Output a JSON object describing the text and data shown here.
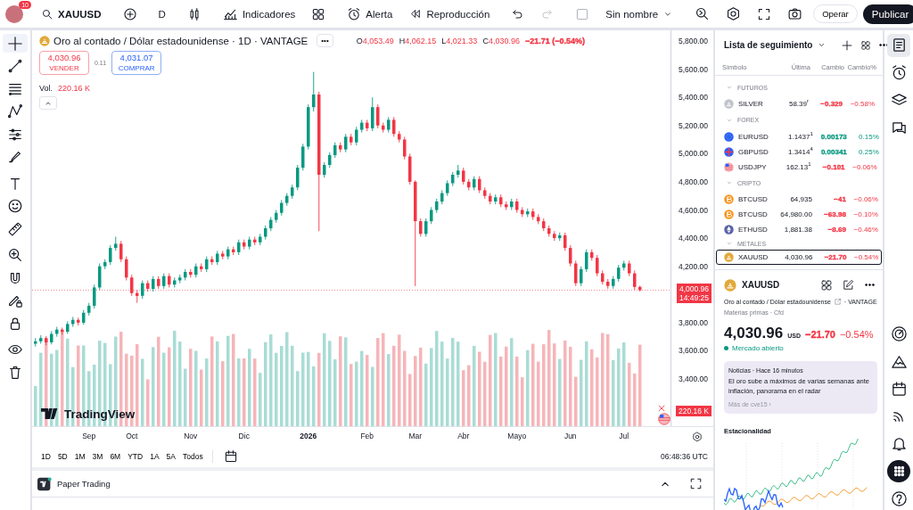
{
  "topbar": {
    "badge": "10",
    "symbol": "XAUUSD",
    "interval": "D",
    "indicators": "Indicadores",
    "alert": "Alerta",
    "replay": "Reproducción",
    "redo_disabled": true,
    "layout_checked": false,
    "layout": "Sin nombre",
    "trade": "Operar",
    "publish": "Publicar"
  },
  "left_tools": [
    {
      "selected": true
    },
    {
      "selected": false
    },
    {
      "selected": false
    },
    {
      "selected": false
    },
    {
      "selected": false
    },
    {
      "selected": false
    },
    {
      "selected": false
    },
    {
      "selected": false
    },
    {
      "selected": false
    },
    {
      "selected": false
    },
    {
      "selected": false
    },
    {
      "selected": false
    },
    {
      "selected": false
    },
    {
      "selected": false
    },
    {
      "selected": false
    }
  ],
  "chart": {
    "title": "Oro al contado / Dólar estadounidense · 1D · VANTAGE",
    "more": "•••",
    "color": "#f23645",
    "ohlc": [
      {
        "label": "O",
        "value": "4,053.49"
      },
      {
        "label": "H",
        "value": "4,062.15"
      },
      {
        "label": "L",
        "value": "4,021.33"
      },
      {
        "label": "C",
        "value": "4,030.96"
      }
    ],
    "change": "−21.71 (−0.54%)",
    "sell": {
      "price": "4,030.96",
      "label": "VENDER"
    },
    "spread": "0.11",
    "buy": {
      "price": "4,031.07",
      "label": "COMPRAR"
    },
    "volume": {
      "label": "Vol.",
      "value": "220.16 K"
    },
    "last_price": "4,000.96",
    "countdown": "14:49:25",
    "volume_tag": "220.16 K",
    "logo": "TradingView",
    "chart_data": {
      "type": "candlestick",
      "ylim": [
        3064.4,
        5876
      ],
      "categories": [
        null,
        null,
        null,
        null,
        null,
        null,
        null,
        null,
        null,
        null,
        "Sep",
        null,
        null,
        null,
        null,
        null,
        null,
        null,
        "Oct",
        null,
        null,
        null,
        null,
        null,
        null,
        null,
        null,
        null,
        null,
        "Nov",
        null,
        null,
        null,
        null,
        null,
        null,
        null,
        null,
        null,
        "Dic",
        null,
        null,
        null,
        null,
        null,
        null,
        null,
        null,
        null,
        null,
        null,
        "2026",
        null,
        null,
        null,
        null,
        null,
        null,
        null,
        null,
        null,
        null,
        "Feb",
        null,
        null,
        null,
        null,
        null,
        null,
        null,
        null,
        "Mar",
        null,
        null,
        null,
        null,
        null,
        null,
        null,
        null,
        "Abr",
        null,
        null,
        null,
        null,
        null,
        null,
        null,
        null,
        null,
        "Mayo",
        null,
        null,
        null,
        null,
        null,
        null,
        null,
        null,
        null,
        "Jun",
        null,
        null,
        null,
        null,
        null,
        null,
        null,
        null,
        null,
        "Jul",
        null,
        null,
        null
      ],
      "yticks": [
        {
          "value": 5800,
          "label": "5,800.00"
        },
        {
          "value": 5600,
          "label": "5,600.00"
        },
        {
          "value": 5400,
          "label": "5,400.00"
        },
        {
          "value": 5200,
          "label": "5,200.00"
        },
        {
          "value": 5000,
          "label": "5,000.00"
        },
        {
          "value": 4800,
          "label": "4,800.00"
        },
        {
          "value": 4600,
          "label": "4,600.00"
        },
        {
          "value": 4400,
          "label": "4,400.00"
        },
        {
          "value": 4200,
          "label": "4,200.00"
        },
        {
          "value": 3800,
          "label": "3,800.00"
        },
        {
          "value": 3600,
          "label": "3,600.00"
        },
        {
          "value": 3400,
          "label": "3,400.00"
        }
      ],
      "ohlc": [
        [
          3650,
          3690,
          3630,
          3667
        ],
        [
          3667,
          3710,
          3650,
          3690
        ],
        [
          3690,
          3705,
          3640,
          3660
        ],
        [
          3660,
          3740,
          3645,
          3720
        ],
        [
          3720,
          3770,
          3700,
          3750
        ],
        [
          3750,
          3765,
          3715,
          3735
        ],
        [
          3735,
          3810,
          3720,
          3790
        ],
        [
          3790,
          3840,
          3770,
          3820
        ],
        [
          3820,
          3835,
          3780,
          3800
        ],
        [
          3800,
          3890,
          3785,
          3870
        ],
        [
          3870,
          3940,
          3850,
          3920
        ],
        [
          3920,
          4070,
          3900,
          4050
        ],
        [
          4050,
          4220,
          4030,
          4200
        ],
        [
          4200,
          4250,
          4180,
          4230
        ],
        [
          4230,
          4350,
          4210,
          4330
        ],
        [
          4330,
          4410,
          4310,
          4360
        ],
        [
          4360,
          4380,
          4230,
          4250
        ],
        [
          4250,
          4270,
          4100,
          4120
        ],
        [
          4120,
          4140,
          3990,
          4010
        ],
        [
          4010,
          4030,
          3940,
          3990
        ],
        [
          3990,
          4100,
          3970,
          4080
        ],
        [
          4080,
          4100,
          4020,
          4040
        ],
        [
          4040,
          4130,
          4020,
          4110
        ],
        [
          4110,
          4130,
          4040,
          4060
        ],
        [
          4060,
          4150,
          4040,
          4130
        ],
        [
          4130,
          4150,
          4050,
          4070
        ],
        [
          4070,
          4120,
          4050,
          4100
        ],
        [
          4100,
          4140,
          4080,
          4120
        ],
        [
          4120,
          4180,
          4100,
          4160
        ],
        [
          4160,
          4180,
          4120,
          4140
        ],
        [
          4140,
          4220,
          4120,
          4200
        ],
        [
          4200,
          4220,
          4160,
          4180
        ],
        [
          4180,
          4270,
          4160,
          4250
        ],
        [
          4250,
          4270,
          4210,
          4230
        ],
        [
          4230,
          4310,
          4210,
          4290
        ],
        [
          4290,
          4310,
          4250,
          4270
        ],
        [
          4270,
          4340,
          4250,
          4320
        ],
        [
          4320,
          4340,
          4280,
          4300
        ],
        [
          4300,
          4390,
          4280,
          4370
        ],
        [
          4370,
          4390,
          4320,
          4340
        ],
        [
          4340,
          4410,
          4320,
          4390
        ],
        [
          4390,
          4410,
          4350,
          4370
        ],
        [
          4370,
          4430,
          4350,
          4410
        ],
        [
          4410,
          4490,
          4390,
          4470
        ],
        [
          4470,
          4550,
          4450,
          4530
        ],
        [
          4530,
          4600,
          4510,
          4580
        ],
        [
          4580,
          4670,
          4560,
          4650
        ],
        [
          4650,
          4720,
          4630,
          4700
        ],
        [
          4700,
          4780,
          4680,
          4760
        ],
        [
          4760,
          4920,
          4740,
          4900
        ],
        [
          4900,
          5070,
          4880,
          5050
        ],
        [
          5050,
          5350,
          5030,
          5330
        ],
        [
          5330,
          5580,
          5300,
          5420
        ],
        [
          5420,
          5440,
          4450,
          4850
        ],
        [
          4850,
          4940,
          4830,
          4920
        ],
        [
          4920,
          5010,
          4900,
          4990
        ],
        [
          4990,
          5080,
          4970,
          5060
        ],
        [
          5060,
          5080,
          5010,
          5030
        ],
        [
          5030,
          5140,
          5010,
          5120
        ],
        [
          5120,
          5140,
          5060,
          5080
        ],
        [
          5080,
          5190,
          5060,
          5170
        ],
        [
          5170,
          5240,
          5150,
          5220
        ],
        [
          5220,
          5240,
          5160,
          5180
        ],
        [
          5180,
          5400,
          5160,
          5330
        ],
        [
          5330,
          5350,
          5180,
          5200
        ],
        [
          5200,
          5220,
          5150,
          5170
        ],
        [
          5170,
          5260,
          5150,
          5240
        ],
        [
          5240,
          5260,
          5120,
          5140
        ],
        [
          5140,
          5160,
          5080,
          5100
        ],
        [
          5100,
          5120,
          4960,
          4980
        ],
        [
          4980,
          5000,
          4780,
          4800
        ],
        [
          4800,
          4810,
          4060,
          4520
        ],
        [
          4520,
          4540,
          4410,
          4430
        ],
        [
          4430,
          4540,
          4410,
          4520
        ],
        [
          4520,
          4620,
          4500,
          4600
        ],
        [
          4600,
          4680,
          4580,
          4660
        ],
        [
          4660,
          4740,
          4640,
          4720
        ],
        [
          4720,
          4810,
          4700,
          4790
        ],
        [
          4790,
          4870,
          4770,
          4850
        ],
        [
          4850,
          4920,
          4830,
          4880
        ],
        [
          4880,
          4900,
          4780,
          4800
        ],
        [
          4800,
          4820,
          4740,
          4760
        ],
        [
          4760,
          4840,
          4740,
          4820
        ],
        [
          4820,
          4840,
          4720,
          4740
        ],
        [
          4740,
          4760,
          4680,
          4700
        ],
        [
          4700,
          4720,
          4640,
          4660
        ],
        [
          4660,
          4710,
          4640,
          4690
        ],
        [
          4690,
          4710,
          4620,
          4640
        ],
        [
          4640,
          4660,
          4600,
          4620
        ],
        [
          4620,
          4680,
          4600,
          4660
        ],
        [
          4660,
          4680,
          4580,
          4600
        ],
        [
          4600,
          4620,
          4550,
          4570
        ],
        [
          4570,
          4610,
          4550,
          4590
        ],
        [
          4590,
          4610,
          4530,
          4550
        ],
        [
          4550,
          4570,
          4500,
          4520
        ],
        [
          4520,
          4540,
          4450,
          4470
        ],
        [
          4470,
          4490,
          4410,
          4430
        ],
        [
          4430,
          4450,
          4380,
          4400
        ],
        [
          4400,
          4440,
          4380,
          4420
        ],
        [
          4420,
          4440,
          4310,
          4330
        ],
        [
          4330,
          4350,
          4200,
          4220
        ],
        [
          4220,
          4240,
          4060,
          4080
        ],
        [
          4080,
          4200,
          4060,
          4180
        ],
        [
          4180,
          4320,
          4160,
          4300
        ],
        [
          4300,
          4320,
          4240,
          4260
        ],
        [
          4260,
          4280,
          4130,
          4150
        ],
        [
          4150,
          4170,
          4070,
          4090
        ],
        [
          4090,
          4110,
          4040,
          4060
        ],
        [
          4060,
          4130,
          4040,
          4110
        ],
        [
          4110,
          4210,
          4090,
          4190
        ],
        [
          4190,
          4240,
          4170,
          4220
        ],
        [
          4220,
          4240,
          4130,
          4150
        ],
        [
          4150,
          4170,
          4033,
          4053.49
        ],
        [
          4053.49,
          4062.15,
          4021.33,
          4030.96
        ]
      ]
    }
  },
  "ranges": [
    "1D",
    "5D",
    "1M",
    "3M",
    "6M",
    "YTD",
    "1A",
    "5A",
    "Todos"
  ],
  "clock": "06:48:36 UTC",
  "bottom_panel": {
    "title": "Paper Trading"
  },
  "watchlist": {
    "title": "Lista de seguimiento",
    "columns": [
      "Símbolo",
      "Última",
      "Cambio",
      "Cambio%"
    ],
    "groups": [
      {
        "name": "FUTUROS",
        "expanded": true,
        "items": [
          {
            "kind": "silver",
            "symbol": "SILVER",
            "last": "58.39$^{r}$",
            "change": "−0.329",
            "change_pct": "−0.58%",
            "color": "#f23645",
            "selected": false
          }
        ]
      },
      {
        "name": "FOREX",
        "expanded": true,
        "items": [
          {
            "kind": "eu-flag",
            "symbol": "EURUSD",
            "last": "1.1437$^{1}$",
            "change": "0.00173",
            "change_pct": "0.15%",
            "color": "#089981",
            "selected": false
          },
          {
            "kind": "uk-flag",
            "symbol": "GBPUSD",
            "last": "1.3414$^{4}$",
            "change": "0.00341",
            "change_pct": "0.25%",
            "color": "#089981",
            "selected": false
          },
          {
            "kind": "us-flag",
            "symbol": "USDJPY",
            "last": "162.13$^{1}$",
            "change": "−0.101",
            "change_pct": "−0.06%",
            "color": "#f23645",
            "selected": false
          }
        ]
      },
      {
        "name": "CRIPTO",
        "expanded": true,
        "items": [
          {
            "kind": "bitcoin",
            "symbol": "BTCUSD",
            "last": "64,935",
            "change": "−41",
            "change_pct": "−0.06%",
            "color": "#f23645",
            "selected": false
          },
          {
            "kind": "bitcoin",
            "symbol": "BTCUSD",
            "last": "64,980.00",
            "change": "−63.98",
            "change_pct": "−0.10%",
            "color": "#f23645",
            "selected": false
          },
          {
            "kind": "ether",
            "symbol": "ETHUSD",
            "last": "1,881.38",
            "change": "−8.69",
            "change_pct": "−0.46%",
            "color": "#f23645",
            "selected": false
          }
        ]
      },
      {
        "name": "METALES",
        "expanded": true,
        "items": [
          {
            "kind": "gold",
            "symbol": "XAUUSD",
            "last": "4,030.96",
            "change": "−21.70",
            "change_pct": "−0.54%",
            "color": "#f23645",
            "selected": true
          }
        ]
      }
    ]
  },
  "details": {
    "symbol": "XAUUSD",
    "description": "Oro al contado / Dólar estadounidense",
    "exchange": "· VANTAGE",
    "category": "Materias primas · Cfd",
    "price": "4,030.96",
    "currency": "USD",
    "change": "−21.70",
    "change_pct": "−0.54%",
    "color": "#f23645",
    "status": "Mercado abierto",
    "news": {
      "meta": "Noticias · Hace 16 minutos",
      "headline": "El oro sube a máximos de varias semanas ante inflación, panorama en el radar",
      "source": "Más de cve15 ›"
    },
    "seasonality": "Estacionalidad"
  },
  "right_tools": [
    {
      "selected": true
    },
    {
      "selected": false
    },
    {
      "selected": false
    },
    {
      "selected": false
    },
    {
      "selected": false
    },
    {
      "selected": false
    },
    {
      "selected": false
    },
    {
      "selected": false
    },
    {
      "selected": false
    },
    {
      "selected": false
    },
    {
      "selected": false
    }
  ]
}
